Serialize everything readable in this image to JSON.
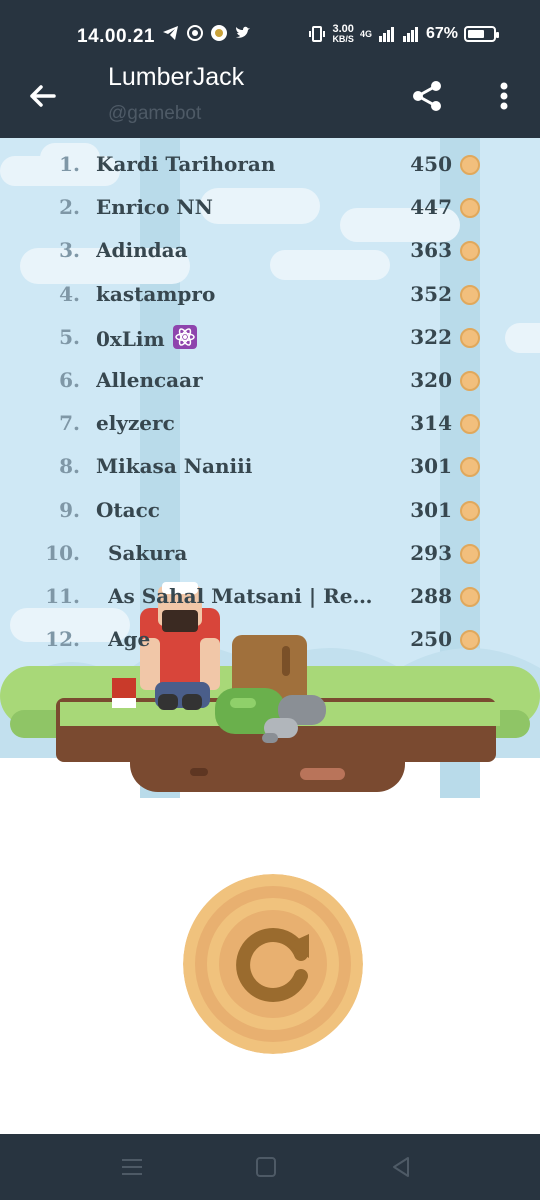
{
  "status_bar": {
    "time": "14.00.21",
    "net_speed_value": "3.00",
    "net_speed_unit": "KB/S",
    "network": "4G",
    "battery": "67%",
    "battery_level": 0.67
  },
  "app_bar": {
    "title": "LumberJack",
    "subtitle": "@gamebot"
  },
  "leaderboard": [
    {
      "rank": "1.",
      "name": "Kardi Tarihoran",
      "score": "450"
    },
    {
      "rank": "2.",
      "name": "Enrico NN",
      "score": "447"
    },
    {
      "rank": "3.",
      "name": "Adindaa",
      "score": "363"
    },
    {
      "rank": "4.",
      "name": "kastampro",
      "score": "352"
    },
    {
      "rank": "5.",
      "name": "0xLim",
      "score": "322",
      "emoji": "atom"
    },
    {
      "rank": "6.",
      "name": "Allencaar",
      "score": "320"
    },
    {
      "rank": "7.",
      "name": "elyzerc",
      "score": "314"
    },
    {
      "rank": "8.",
      "name": "Mikasa Naniii",
      "score": "301"
    },
    {
      "rank": "9.",
      "name": "Otacc",
      "score": "301"
    },
    {
      "rank": "10.",
      "name": "Sakura",
      "score": "293"
    },
    {
      "rank": "11.",
      "name": "As Sahal Matsani | Reff...",
      "score": "288"
    },
    {
      "rank": "12.",
      "name": "Age",
      "score": "250"
    }
  ],
  "colors": {
    "bar": "#283440",
    "sky": "#cfe8f5",
    "grass": "#a8d878",
    "dirt": "#7a4a30",
    "coin": "#f2bf7d",
    "wood": "#e8b070"
  },
  "icons": {
    "back": "arrow-left-icon",
    "share": "share-icon",
    "more": "more-vert-icon",
    "restart": "restart-icon"
  }
}
